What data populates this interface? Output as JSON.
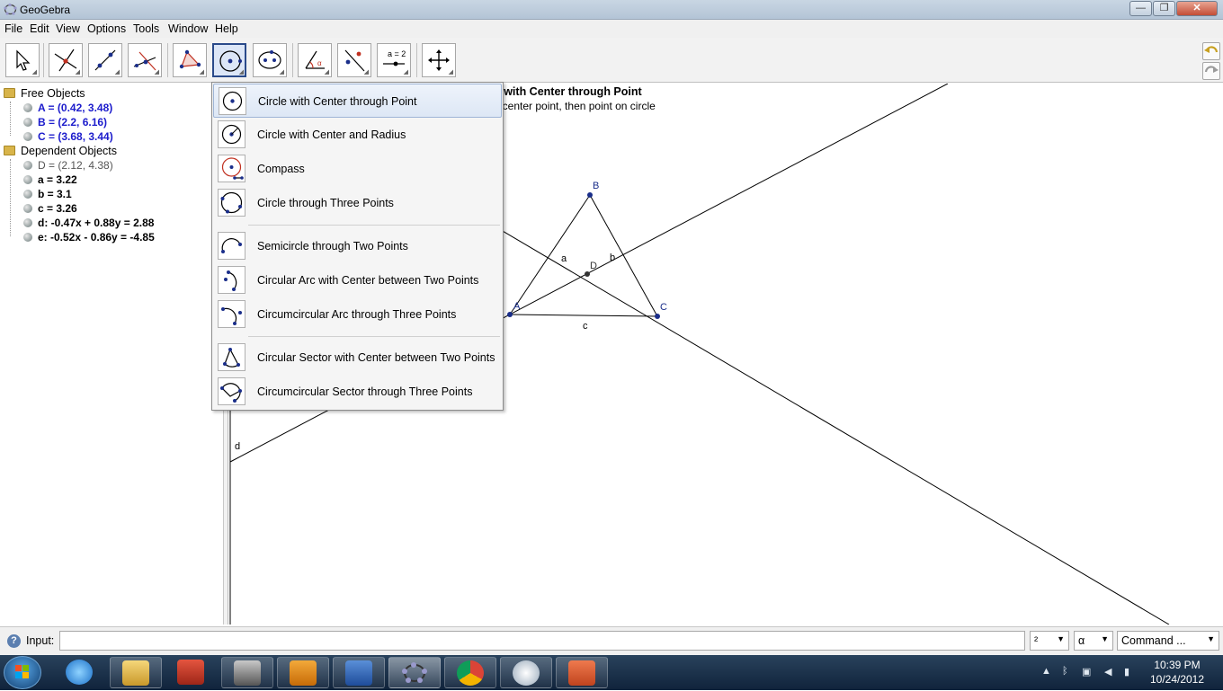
{
  "window": {
    "title": "GeoGebra",
    "buttons": {
      "minimize": "—",
      "maximize": "❐",
      "close": "✕"
    }
  },
  "menu": [
    "File",
    "Edit",
    "View",
    "Options",
    "Tools",
    "Window",
    "Help"
  ],
  "toolbar": {
    "active_tool_title": "Circle with Center through Point",
    "active_tool_help": "Select center point, then point on circle",
    "tools": [
      "move",
      "point",
      "line-through-two-points",
      "perpendicular-line",
      "polygon",
      "circle-with-center-through-point",
      "conic-through-five-points",
      "angle",
      "reflect-about-line",
      "slider",
      "move-graphics-view"
    ],
    "slider_label": "a = 2"
  },
  "algebra": {
    "free_label": "Free Objects",
    "free": [
      "A = (0.42, 3.48)",
      "B = (2.2, 6.16)",
      "C = (3.68, 3.44)"
    ],
    "dependent_label": "Dependent Objects",
    "dependent": [
      "D = (2.12, 4.38)",
      "a = 3.22",
      "b = 3.1",
      "c = 3.26",
      "d: -0.47x + 0.88y = 2.88",
      "e: -0.52x - 0.86y = -4.85"
    ]
  },
  "graphics": {
    "points": {
      "A": "A",
      "B": "B",
      "C": "C",
      "D": "D"
    },
    "segments": {
      "a": "a",
      "b": "b",
      "c": "c"
    },
    "lines": {
      "d": "d"
    }
  },
  "dropdown": {
    "items": [
      "Circle with Center through Point",
      "Circle with Center and Radius",
      "Compass",
      "Circle through Three Points",
      "Semicircle through Two Points",
      "Circular Arc with Center between Two Points",
      "Circumcircular Arc through Three Points",
      "Circular Sector with Center between Two Points",
      "Circumcircular Sector through Three Points"
    ]
  },
  "inputbar": {
    "label": "Input:",
    "value": "",
    "combo1": "²",
    "combo2": "α",
    "combo3": "Command ..."
  },
  "taskbar": {
    "time": "10:39 PM",
    "date": "10/24/2012"
  },
  "colors": {
    "accent": "#2a4a8a",
    "point": "#1a2e8a",
    "free_text": "#1c1ccc"
  }
}
